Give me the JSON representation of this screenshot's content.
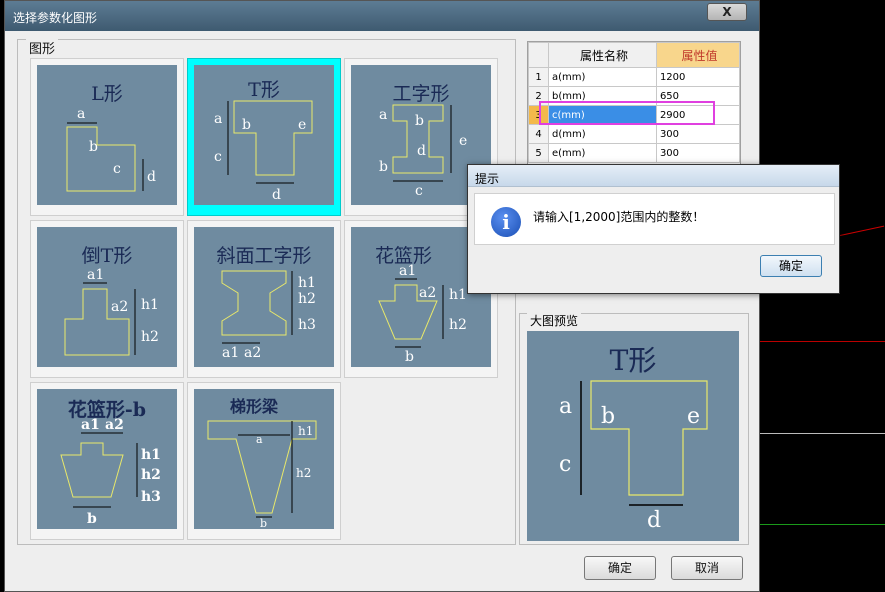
{
  "window": {
    "title": "选择参数化图形",
    "close_label": "X"
  },
  "group_label": "图形",
  "tiles": [
    {
      "name": "L形"
    },
    {
      "name": "T形"
    },
    {
      "name": "工字形"
    },
    {
      "name": "倒T形"
    },
    {
      "name": "斜面工字形"
    },
    {
      "name": "花篮形"
    },
    {
      "name": "花篮形-b"
    },
    {
      "name": "梯形梁"
    }
  ],
  "selected_tile": "T形",
  "dims": {
    "a": "a",
    "b": "b",
    "c": "c",
    "d": "d",
    "e": "e",
    "a1": "a1",
    "a2": "a2",
    "h1": "h1",
    "h2": "h2",
    "h3": "h3"
  },
  "grid": {
    "headers": [
      "属性名称",
      "属性值"
    ],
    "rows": [
      {
        "idx": "1",
        "name": "a(mm)",
        "value": "1200"
      },
      {
        "idx": "2",
        "name": "b(mm)",
        "value": "650"
      },
      {
        "idx": "3",
        "name": "c(mm)",
        "value": "2900"
      },
      {
        "idx": "4",
        "name": "d(mm)",
        "value": "300"
      },
      {
        "idx": "5",
        "name": "e(mm)",
        "value": "300"
      }
    ],
    "selected_row": "3"
  },
  "preview": {
    "label": "大图预览",
    "shape_name": "T形"
  },
  "buttons": {
    "ok": "确定",
    "cancel": "取消"
  },
  "dialog": {
    "title": "提示",
    "message": "请输入[1,2000]范围内的整数！",
    "ok": "确定",
    "icon": "info-icon",
    "icon_glyph": "i"
  },
  "colors": {
    "tile_bg": "#6f8ba0",
    "shape_stroke": "#e8e86a",
    "selected": "#00ffff",
    "highlight": "#e040e0",
    "selected_cell": "#3a8ee6"
  }
}
